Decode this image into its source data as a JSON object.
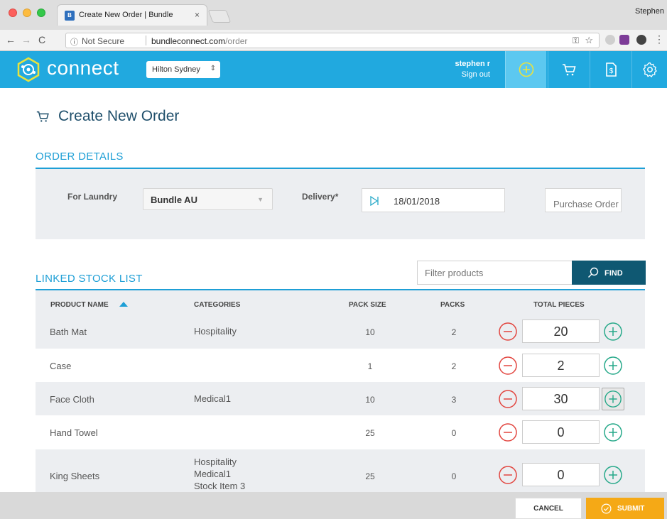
{
  "browser": {
    "tab_title": "Create New Order | Bundle",
    "tab_close": "×",
    "profile_name": "Stephen",
    "security_label": "Not Secure",
    "url_domain": "bundleconnect.com",
    "url_path": "/order"
  },
  "header": {
    "logo_text": "connect",
    "location": "Hilton Sydney",
    "user_name": "stephen r",
    "sign_out": "Sign out"
  },
  "page": {
    "title": "Create New Order"
  },
  "order_details": {
    "section_title": "ORDER DETAILS",
    "laundry_label": "For Laundry",
    "laundry_value": "Bundle AU",
    "delivery_label": "Delivery*",
    "delivery_date": "18/01/2018",
    "po_placeholder": "Purchase Order"
  },
  "stock": {
    "section_title": "LINKED STOCK LIST",
    "filter_placeholder": "Filter products",
    "find_label": "FIND",
    "columns": {
      "product": "PRODUCT NAME",
      "categories": "CATEGORIES",
      "pack_size": "PACK SIZE",
      "packs": "PACKS",
      "total": "TOTAL PIECES"
    },
    "rows": [
      {
        "name": "Bath Mat",
        "cat1": "Hospitality",
        "cat2": "",
        "cat3": "",
        "pack_size": "10",
        "packs": "2",
        "total": "20"
      },
      {
        "name": "Case",
        "cat1": "",
        "cat2": "",
        "cat3": "",
        "pack_size": "1",
        "packs": "2",
        "total": "2"
      },
      {
        "name": "Face Cloth",
        "cat1": "Medical1",
        "cat2": "",
        "cat3": "",
        "pack_size": "10",
        "packs": "3",
        "total": "30"
      },
      {
        "name": "Hand Towel",
        "cat1": "",
        "cat2": "",
        "cat3": "",
        "pack_size": "25",
        "packs": "0",
        "total": "0"
      },
      {
        "name": "King Sheets",
        "cat1": "Hospitality",
        "cat2": "Medical1",
        "cat3": "Stock Item 3",
        "pack_size": "25",
        "packs": "0",
        "total": "0"
      }
    ]
  },
  "footer": {
    "cancel_label": "CANCEL",
    "submit_label": "SUBMIT"
  },
  "colors": {
    "brand_blue": "#21a9df",
    "dark_teal": "#0f5872",
    "submit_orange": "#f5a916",
    "minus_red": "#e2453f",
    "plus_green": "#27a98a"
  }
}
